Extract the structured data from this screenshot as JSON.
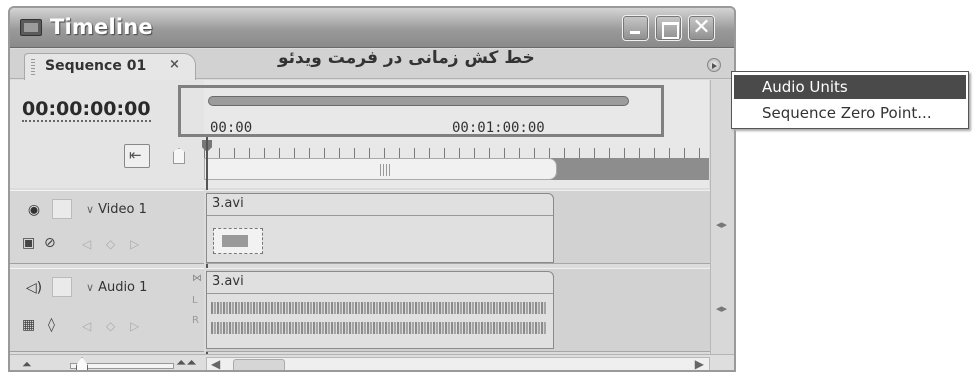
{
  "window": {
    "title": "Timeline",
    "icon": "timeline-panel-icon",
    "controls": [
      "minimize-icon",
      "maximize-icon",
      "close-icon"
    ]
  },
  "tab": {
    "label": "Sequence 01",
    "close": "×"
  },
  "caption": "خط کش زمانی در فرمت ویدئو",
  "timecode": "00:00:00:00",
  "ruler": {
    "labels": [
      "00:00",
      "00:01:00:00"
    ]
  },
  "tracks": {
    "video": {
      "name": "Video 1",
      "clip": "3.avi"
    },
    "audio": {
      "name": "Audio 1",
      "clip": "3.avi",
      "channels": [
        "L",
        "R"
      ]
    }
  },
  "flyout_menu": {
    "items": [
      {
        "label": "Audio Units",
        "selected": true
      },
      {
        "label": "Sequence Zero Point...",
        "selected": false
      }
    ]
  },
  "colors": {
    "title_gradient_top": "#d4d4d4",
    "title_gradient_bottom": "#8a8a8a",
    "menu_highlight": "#4a4a4a",
    "panel_bg": "#dcdcdc"
  }
}
